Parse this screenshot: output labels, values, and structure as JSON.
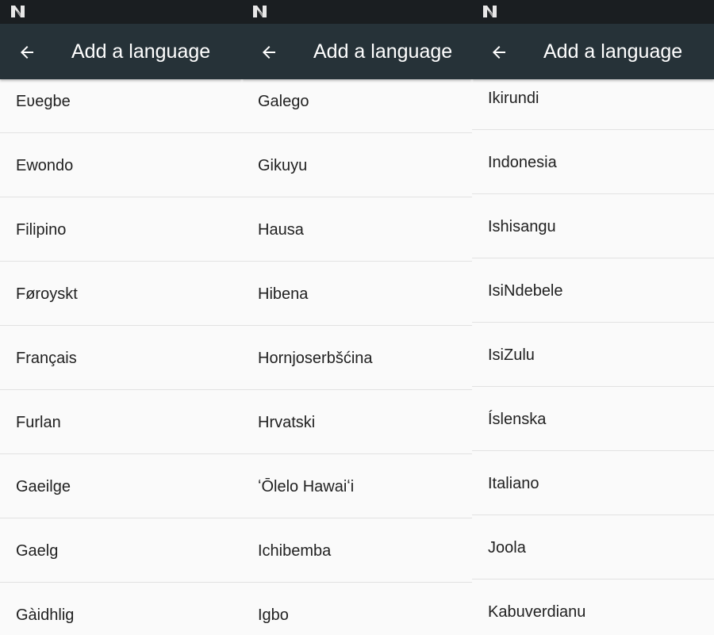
{
  "panels": [
    {
      "title": "Add a language",
      "back_icon": "arrow-back-icon",
      "status_logo": "nougat-n-icon",
      "languages": [
        "Eʋegbe",
        "Ewondo",
        "Filipino",
        "Føroyskt",
        "Français",
        "Furlan",
        "Gaeilge",
        "Gaelg",
        "Gàidhlig"
      ]
    },
    {
      "title": "Add a language",
      "back_icon": "arrow-back-icon",
      "status_logo": "nougat-n-icon",
      "languages": [
        "Galego",
        "Gikuyu",
        "Hausa",
        "Hibena",
        "Hornjoserbšćina",
        "Hrvatski",
        "ʻŌlelo Hawaiʻi",
        "Ichibemba",
        "Igbo"
      ]
    },
    {
      "title": "Add a language",
      "back_icon": "arrow-back-icon",
      "status_logo": "nougat-n-icon",
      "languages": [
        "Ikirundi",
        "Indonesia",
        "Ishisangu",
        "IsiNdebele",
        "IsiZulu",
        "Íslenska",
        "Italiano",
        "Joola",
        "Kabuverdianu"
      ]
    }
  ],
  "colors": {
    "status_bar": "#1a1e21",
    "app_bar": "#263238",
    "background": "#fafafa",
    "text": "#212121",
    "divider": "#e2e2e2"
  }
}
